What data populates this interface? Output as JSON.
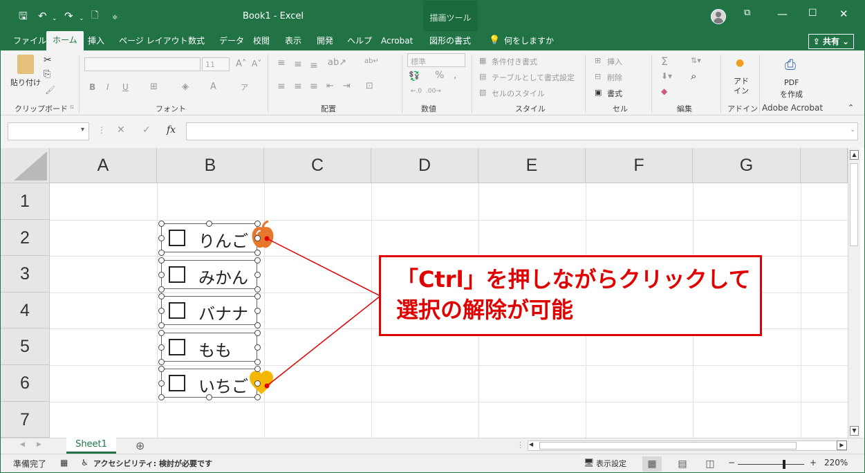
{
  "titlebar": {
    "title": "Book1  -  Excel",
    "context_tab": "描画ツール",
    "save_icon": "🖫",
    "undo_icon": "↶",
    "redo_icon": "↷"
  },
  "menu": {
    "tabs": [
      "ファイル",
      "ホーム",
      "挿入",
      "ページ レイアウト",
      "数式",
      "データ",
      "校閲",
      "表示",
      "開発",
      "ヘルプ",
      "Acrobat",
      "図形の書式"
    ],
    "active": "ホーム",
    "tell_me": "何をしますか",
    "share": "共有"
  },
  "ribbon": {
    "clipboard": {
      "paste": "貼り付け",
      "label": "クリップボード"
    },
    "font": {
      "size": "11",
      "label": "フォント",
      "bold": "B",
      "italic": "I",
      "underline": "U"
    },
    "alignment": {
      "label": "配置"
    },
    "number": {
      "format": "標準",
      "label": "数値",
      "percent": "%"
    },
    "styles": {
      "conditional": "条件付き書式",
      "table": "テーブルとして書式設定",
      "cell_styles": "セルのスタイル",
      "label": "スタイル"
    },
    "cells": {
      "insert": "挿入",
      "delete": "削除",
      "format": "書式",
      "label": "セル"
    },
    "editing": {
      "label": "編集",
      "sum": "Σ"
    },
    "addins": {
      "button": "アド\nイン",
      "label": "アドイン"
    },
    "acrobat": {
      "button1": "PDF",
      "button2": "を作成",
      "label": "Adobe Acrobat"
    }
  },
  "formula_bar": {
    "fx": "fx",
    "cancel": "✕",
    "enter": "✓",
    "value": ""
  },
  "grid": {
    "columns": [
      "A",
      "B",
      "C",
      "D",
      "E",
      "F",
      "G"
    ],
    "rows": [
      "1",
      "2",
      "3",
      "4",
      "5",
      "6",
      "7"
    ]
  },
  "checkboxes": [
    {
      "label": "りんご",
      "checked": false
    },
    {
      "label": "みかん",
      "checked": false
    },
    {
      "label": "バナナ",
      "checked": false
    },
    {
      "label": "もも",
      "checked": false
    },
    {
      "label": "いちご",
      "checked": false
    }
  ],
  "callout": {
    "line1": "「Ctrl」を押しながらクリックして",
    "line2": "選択の解除が可能",
    "color": "#e00000"
  },
  "sheets": {
    "active": "Sheet1",
    "add": "⊕"
  },
  "statusbar": {
    "ready": "準備完了",
    "accessibility": "アクセシビリティ: 検討が必要です",
    "display_settings": "表示設定",
    "zoom": "220%",
    "minus": "−",
    "plus": "+"
  },
  "colors": {
    "excel_green": "#217346",
    "accent_red": "#e00000"
  }
}
